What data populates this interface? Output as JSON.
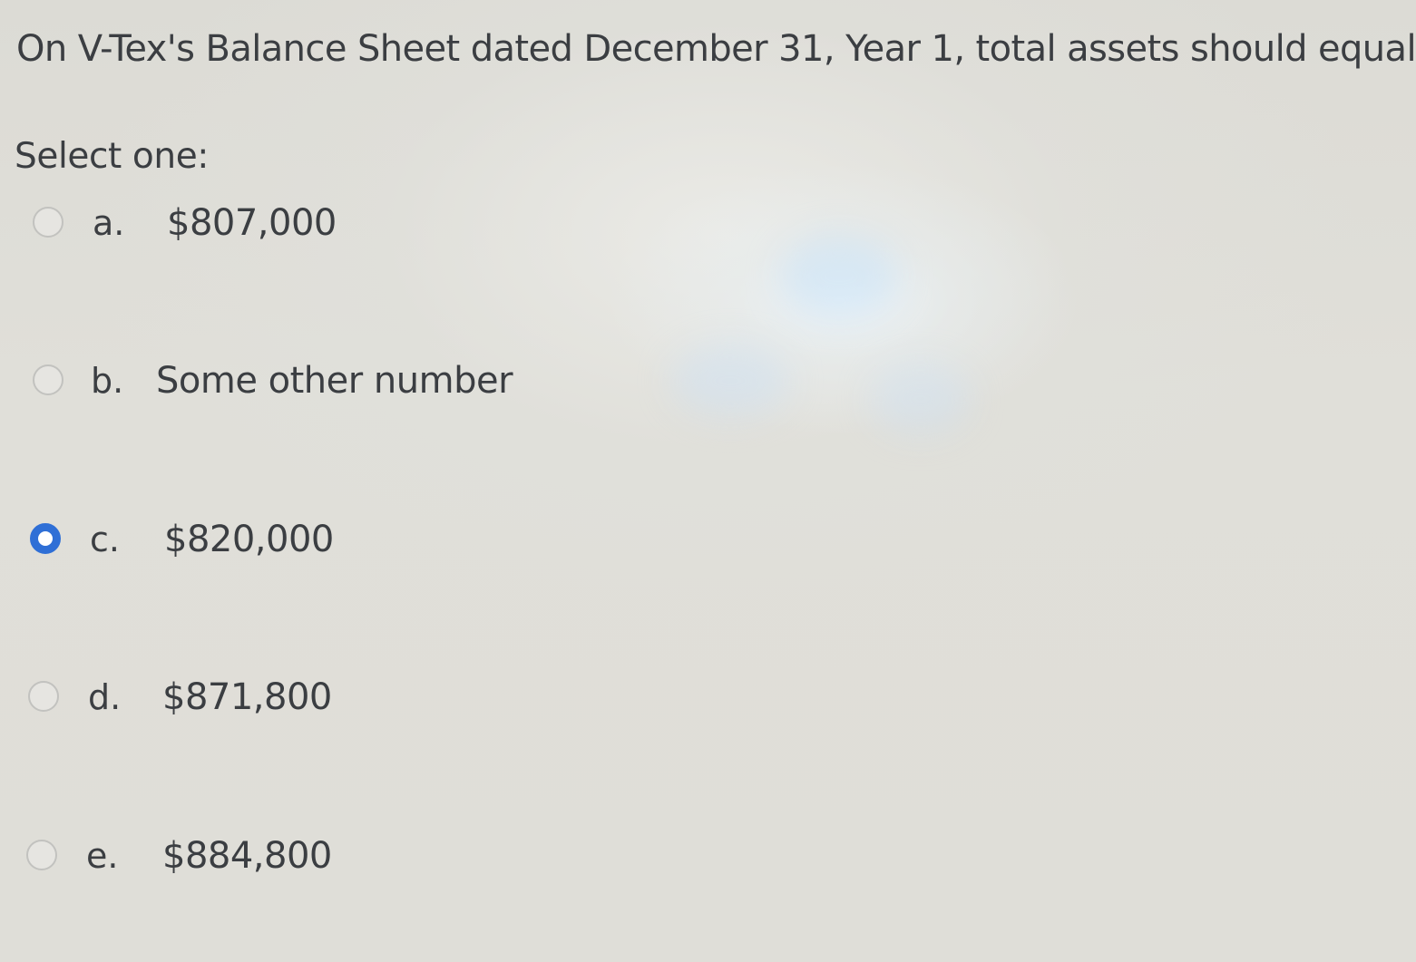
{
  "question": {
    "text": "On V-Tex's Balance Sheet dated December 31, Year 1, total assets should equal"
  },
  "prompt": "Select one:",
  "options": [
    {
      "letter": "a.",
      "text": "$807,000",
      "selected": false
    },
    {
      "letter": "b.",
      "text": "Some other number",
      "selected": false
    },
    {
      "letter": "c.",
      "text": "$820,000",
      "selected": true
    },
    {
      "letter": "d.",
      "text": "$871,800",
      "selected": false
    },
    {
      "letter": "e.",
      "text": "$884,800",
      "selected": false
    }
  ],
  "colors": {
    "background": "#dddcd6",
    "text": "#3b3e42",
    "radio_selected": "#2f6fd6",
    "radio_border": "#c2c2bf"
  }
}
